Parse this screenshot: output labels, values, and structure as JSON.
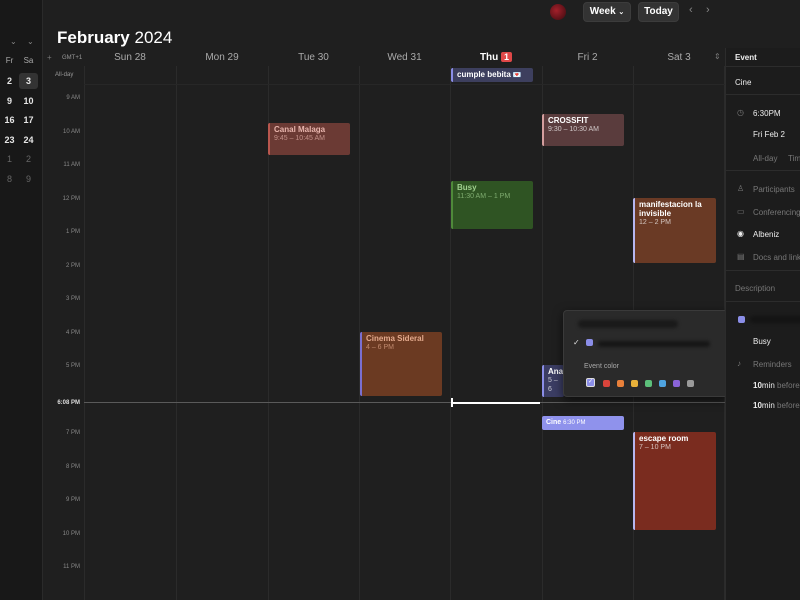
{
  "header": {
    "month": "February",
    "year": "2024",
    "view_label": "Week",
    "today_label": "Today"
  },
  "mini_calendar": {
    "dow": [
      "Fr",
      "Sa"
    ],
    "rows": [
      [
        "2",
        "3"
      ],
      [
        "9",
        "10"
      ],
      [
        "16",
        "17"
      ],
      [
        "23",
        "24"
      ],
      [
        "1",
        "2"
      ],
      [
        "8",
        "9"
      ]
    ]
  },
  "week": {
    "timezone_label": "GMT+1",
    "all_day_label": "All-day",
    "days": [
      {
        "label": "Sun 28"
      },
      {
        "label": "Mon 29"
      },
      {
        "label": "Tue 30"
      },
      {
        "label": "Wed 31"
      },
      {
        "label": "Thu",
        "badge": "1"
      },
      {
        "label": "Fri 2"
      },
      {
        "label": "Sat 3"
      }
    ],
    "hours": [
      "9 AM",
      "10 AM",
      "11 AM",
      "12 PM",
      "1 PM",
      "2 PM",
      "3 PM",
      "4 PM",
      "5 PM",
      "6:08 PM",
      "7 PM",
      "8 PM",
      "9 PM",
      "10 PM",
      "11 PM"
    ],
    "now_label": "6:08 PM"
  },
  "events": {
    "cumple": {
      "title": "cumple bebita",
      "emoji": "💌"
    },
    "canal": {
      "title": "Canal Malaga",
      "time": "9:45 – 10:45 AM"
    },
    "crossfit": {
      "title": "CROSSFIT",
      "time": "9:30 – 10:30 AM"
    },
    "busy": {
      "title": "Busy",
      "time": "11:30 AM – 1 PM"
    },
    "manif": {
      "title": "manifestacion la invisible",
      "time": "12 – 2 PM"
    },
    "cinema": {
      "title": "Cinema Sideral",
      "time": "4 – 6 PM"
    },
    "ana": {
      "title": "Ana",
      "time": "5 – 6"
    },
    "cine": {
      "title": "Cine",
      "time": "6:30 PM"
    },
    "escape": {
      "title": "escape room",
      "time": "7 – 10 PM"
    }
  },
  "popup": {
    "event_color_label": "Event color",
    "colors": [
      "#8b8ee8",
      "#d9443b",
      "#e8803a",
      "#e8b13a",
      "#5cc07a",
      "#4ea3e0",
      "#8a63d8",
      "#9a9a9a"
    ]
  },
  "panel": {
    "header": "Event",
    "title": "Cine",
    "time": "6:30PM",
    "date": "Fri Feb 2",
    "all_day": "All-day",
    "time_zone": "Tim",
    "participants": "Participants",
    "conferencing": "Conferencing",
    "location": "Albeniz",
    "docs": "Docs and links",
    "description": "Description",
    "busy": "Busy",
    "reminders": "Reminders",
    "reminder1_value": "10",
    "reminder1_unit": "min",
    "reminder1_suffix": "before",
    "reminder2_value": "10",
    "reminder2_unit": "min",
    "reminder2_suffix": "before"
  }
}
